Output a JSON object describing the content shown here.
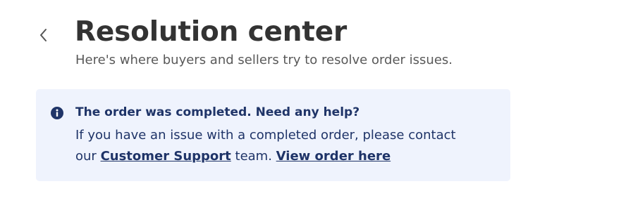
{
  "header": {
    "back_icon": "chevron-left-icon",
    "title": "Resolution center",
    "subtitle": "Here's where buyers and sellers try to resolve order issues."
  },
  "notice": {
    "icon": "info-icon",
    "heading": "The order was completed. Need any help?",
    "body_line1": "If you have an issue with a completed order, please contact",
    "body_prefix": "our",
    "support_link": "Customer Support",
    "body_middle": "team.",
    "order_link": "View order here"
  },
  "colors": {
    "title": "#333333",
    "subtitle": "#595959",
    "notice_background": "#eff3fd",
    "notice_text": "#1f3468"
  }
}
